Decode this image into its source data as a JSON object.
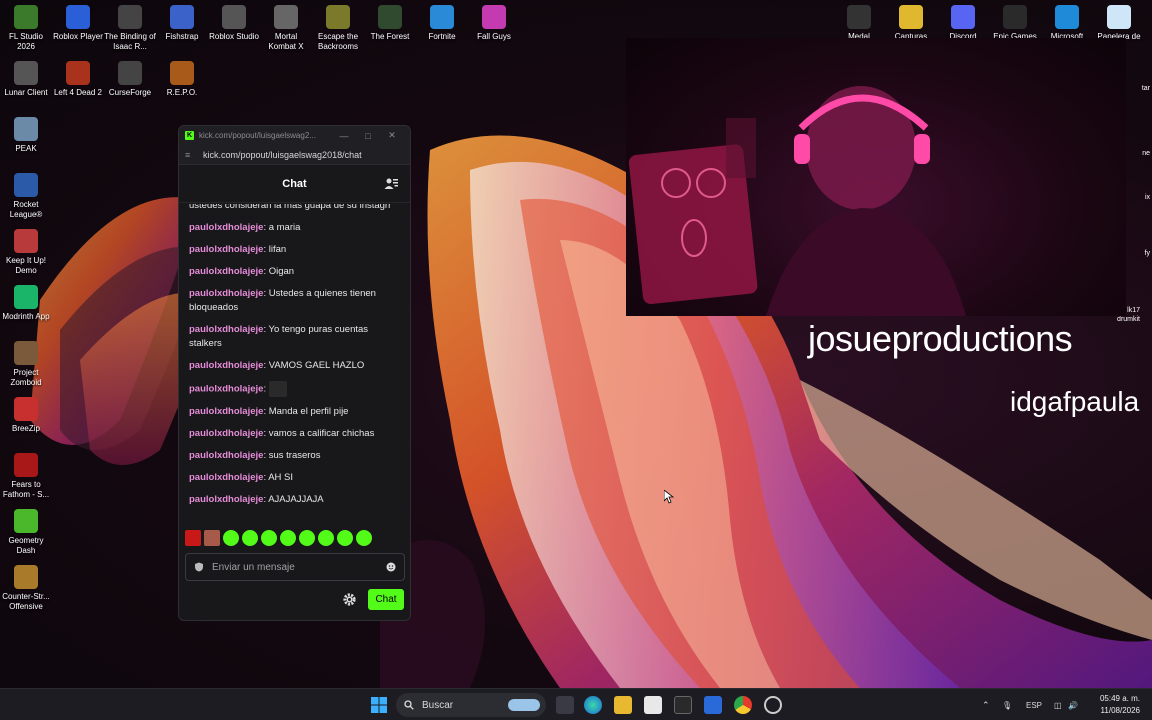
{
  "desktop": {
    "icons_left": [
      {
        "label": "FL Studio 2026",
        "icon": "fl-studio-icon",
        "color": "#3a7a2a"
      },
      {
        "label": "Roblox Player",
        "icon": "roblox-icon",
        "color": "#2a5fd8"
      },
      {
        "label": "The Binding of Isaac R...",
        "icon": "isaac-icon",
        "color": "#444"
      },
      {
        "label": "Fishstrap",
        "icon": "fishstrap-icon",
        "color": "#3b62c9"
      },
      {
        "label": "Roblox Studio",
        "icon": "roblox-studio-icon",
        "color": "#555"
      },
      {
        "label": "Mortal Kombat X",
        "icon": "mortal-kombat-icon",
        "color": "#666"
      },
      {
        "label": "Escape the Backrooms",
        "icon": "backrooms-icon",
        "color": "#7a7a2a"
      },
      {
        "label": "The Forest",
        "icon": "forest-icon",
        "color": "#2f4a2f"
      },
      {
        "label": "Fortnite",
        "icon": "fortnite-icon",
        "color": "#2a8ad8"
      },
      {
        "label": "Fall Guys",
        "icon": "fall-guys-icon",
        "color": "#c43ab0"
      },
      {
        "label": "Lunar Client",
        "icon": "lunar-client-icon",
        "color": "#555"
      },
      {
        "label": "Left 4 Dead 2",
        "icon": "left4dead-icon",
        "color": "#a8321c"
      },
      {
        "label": "CurseForge",
        "icon": "curseforge-icon",
        "color": "#444"
      },
      {
        "label": "R.E.P.O.",
        "icon": "repo-icon",
        "color": "#a85a1a"
      },
      {
        "label": "PEAK",
        "icon": "peak-icon",
        "color": "#6a8aa8"
      },
      {
        "label": "Rocket League®",
        "icon": "rocket-league-icon",
        "color": "#2a5aa8"
      },
      {
        "label": "Keep It Up! Demo",
        "icon": "keep-it-up-icon",
        "color": "#b83a3a"
      },
      {
        "label": "Modrinth App",
        "icon": "modrinth-icon",
        "color": "#1bb56a"
      },
      {
        "label": "Project Zomboid",
        "icon": "zomboid-icon",
        "color": "#7a5a3a"
      },
      {
        "label": "BreeZip",
        "icon": "breezip-icon",
        "color": "#c83030"
      },
      {
        "label": "Fears to Fathom - S...",
        "icon": "fears-icon",
        "color": "#a81818"
      },
      {
        "label": "Geometry Dash",
        "icon": "geometry-dash-icon",
        "color": "#4ab82a"
      },
      {
        "label": "Counter-Str... Offensive",
        "icon": "csgo-icon",
        "color": "#a87a2a"
      }
    ],
    "icons_right": [
      {
        "label": "Medal",
        "icon": "medal-icon",
        "color": "#333"
      },
      {
        "label": "Capturas",
        "icon": "folder-icon",
        "color": "#e0b830"
      },
      {
        "label": "Discord",
        "icon": "discord-icon",
        "color": "#5865f2"
      },
      {
        "label": "Epic Games",
        "icon": "epic-games-icon",
        "color": "#2a2a2a"
      },
      {
        "label": "Microsoft",
        "icon": "edge-icon",
        "color": "#1e8ad8"
      },
      {
        "label": "Papelera de re",
        "icon": "recycle-bin-icon",
        "color": "#cfe6f8"
      }
    ],
    "edge_labels": [
      "tar",
      "ne",
      "ix",
      "fy",
      "lk17 drumkit"
    ]
  },
  "chat_window": {
    "title": "kick.com/popout/luisgaelswag2...",
    "url": "kick.com/popout/luisgaelswag2018/chat",
    "header": "Chat",
    "first_partial": "ustedes consideran la mas guapa de su instagrr",
    "messages": [
      {
        "user": "paulolxdholajeje",
        "text": "a maria"
      },
      {
        "user": "paulolxdholajeje",
        "text": "lifan"
      },
      {
        "user": "paulolxdholajeje",
        "text": "Oigan"
      },
      {
        "user": "paulolxdholajeje",
        "text": "Ustedes a quienes tienen bloqueados"
      },
      {
        "user": "paulolxdholajeje",
        "text": "Yo tengo puras cuentas stalkers"
      },
      {
        "user": "paulolxdholajeje",
        "text": "VAMOS GAEL HAZLO"
      },
      {
        "user": "paulolxdholajeje",
        "text": "",
        "emote": true
      },
      {
        "user": "paulolxdholajeje",
        "text": "Manda el perfil pije"
      },
      {
        "user": "paulolxdholajeje",
        "text": "vamos a calificar chichas"
      },
      {
        "user": "paulolxdholajeje",
        "text": "sus traseros"
      },
      {
        "user": "paulolxdholajeje",
        "text": "AH SI"
      },
      {
        "user": "paulolxdholajeje",
        "text": "AJAJAJJAJA"
      }
    ],
    "emote_colors": [
      "#c81818",
      "#a85a4a",
      "#53fc18",
      "#53fc18",
      "#53fc18",
      "#53fc18",
      "#53fc18",
      "#53fc18",
      "#53fc18",
      "#53fc18"
    ],
    "input_placeholder": "Enviar un mensaje",
    "send_label": "Chat",
    "accent": "#53fc18",
    "username_color": "#e68cd8"
  },
  "overlay": {
    "channel_name": "josueproductions",
    "second_name": "idgafpaula"
  },
  "taskbar": {
    "search_label": "Buscar",
    "lang": "ESP",
    "time": "05:49 a. m.",
    "date": "11/08/2026"
  }
}
